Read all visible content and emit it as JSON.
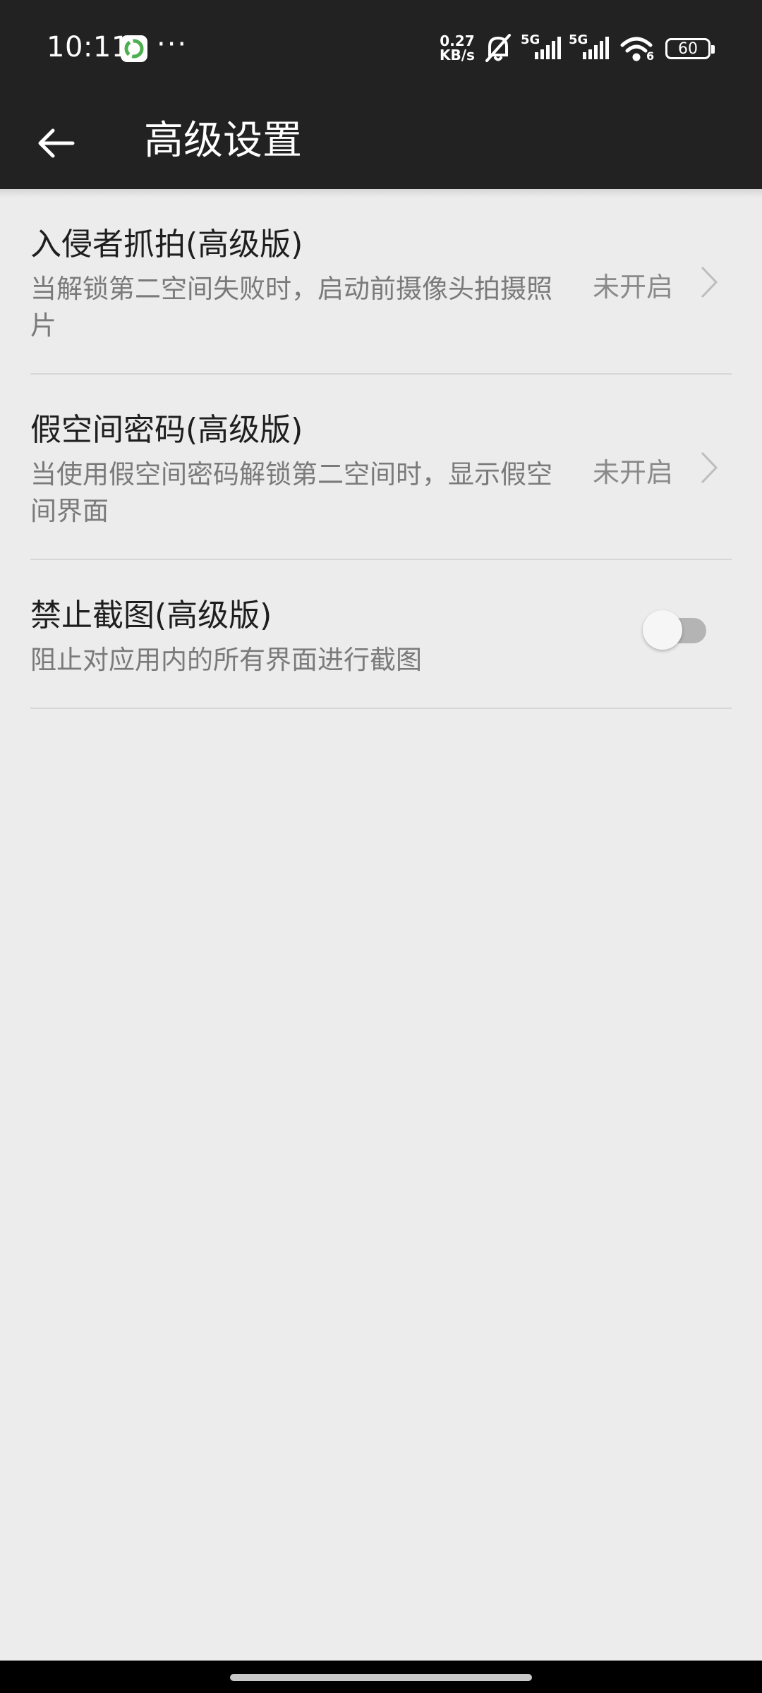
{
  "status_bar": {
    "time": "10:11",
    "dots": "···",
    "speed_value": "0.27",
    "speed_unit": "KB/s",
    "signal_label_1": "5G",
    "signal_label_2": "5G",
    "wifi_label": "6",
    "battery": "60",
    "app_icon": "refresh-circle-icon",
    "icons": [
      "mute-bell-icon",
      "signal-5g-icon",
      "signal-5g-icon",
      "wifi-icon",
      "battery-icon"
    ]
  },
  "header": {
    "title": "高级设置",
    "back_icon": "arrow-left-icon"
  },
  "settings": [
    {
      "title": "入侵者抓拍(高级版)",
      "desc": "当解锁第二空间失败时，启动前摄像头拍摄照片",
      "value": "未开启"
    },
    {
      "title": "假空间密码(高级版)",
      "desc": "当使用假空间密码解锁第二空间时，显示假空间界面",
      "value": "未开启"
    },
    {
      "title": "禁止截图(高级版)",
      "desc": "阻止对应用内的所有界面进行截图",
      "toggle_on": false
    }
  ],
  "colors": {
    "bar_bg": "#222222",
    "page_bg": "#ececec",
    "divider": "#d7d7d7",
    "app_icon_green": "#4caf50"
  }
}
